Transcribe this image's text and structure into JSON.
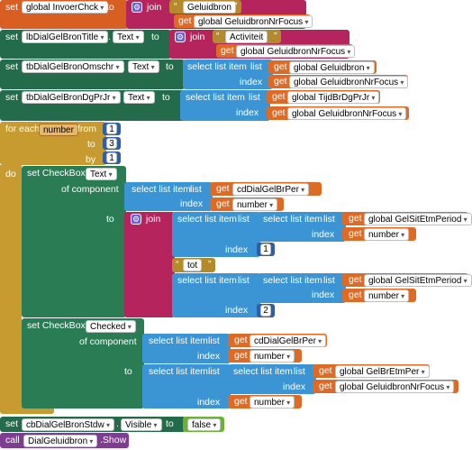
{
  "blocks": {
    "b1": {
      "set": "set",
      "var": "global InvoerChck",
      "to": "to",
      "join": "join",
      "str": "Geluidbron",
      "q1": "“",
      "q2": "”",
      "get": "get",
      "getvar": "global GeluidbronNrFocus"
    },
    "b2": {
      "set": "set",
      "comp": "lbDialGelBronTitle",
      "prop": "Text",
      "to": "to",
      "join": "join",
      "str": "Activiteit",
      "q1": "“",
      "q2": "”",
      "get": "get",
      "getvar": "global GeluidbronNrFocus"
    },
    "b3": {
      "set": "set",
      "comp": "tbDialGelBronOmschr",
      "prop": "Text",
      "to": "to",
      "select": "select list item",
      "list": "list",
      "index": "index",
      "get": "get",
      "listvar": "global Geluidbron",
      "indexvar": "global GeluidbronNrFocus"
    },
    "b4": {
      "set": "set",
      "comp": "tbDialGelBronDgPrJr",
      "prop": "Text",
      "to": "to",
      "select": "select list item",
      "list": "list",
      "index": "index",
      "get": "get",
      "listvar": "global TijdBrDgPrJr",
      "indexvar": "global GeluidbronNrFocus"
    },
    "loop": {
      "foreach": "for each",
      "var": "number",
      "from": "from",
      "to": "to",
      "by": "by",
      "do": "do",
      "from_val": "1",
      "to_val": "3",
      "by_val": "1",
      "s1": {
        "set": "set CheckBox.",
        "prop": "Text",
        "ofcomp": "of component",
        "to": "to",
        "select": "select list item",
        "list": "list",
        "index": "index",
        "get": "get",
        "comp_get": "cdDialGelBrPer",
        "idx_get": "number",
        "join": "join",
        "j1_listvar": "global GelSitEtmPeriod",
        "j1_idxvar": "number",
        "j1_idx2": "1",
        "str": "tot",
        "q1": "“",
        "q2": "”",
        "j3_listvar": "global GelSitEtmPeriod",
        "j3_idxvar": "number",
        "j3_idx2": "2"
      },
      "s2": {
        "set": "set CheckBox.",
        "prop": "Checked",
        "ofcomp": "of component",
        "to": "to",
        "select": "select list item",
        "list": "list",
        "index": "index",
        "get": "get",
        "comp_get": "cdDialGelBrPer",
        "idx_get": "number",
        "listvar": "global GelBrEtmPer",
        "idxvar": "global GeluidbronNrFocus",
        "idx2var": "number"
      }
    },
    "b5": {
      "set": "set",
      "comp": "cbDialGelBronStdw",
      "prop": "Visible",
      "to": "to",
      "val": "false"
    },
    "b6": {
      "call": "call",
      "comp": "DialGeluidbron",
      "method": ".Show"
    }
  }
}
